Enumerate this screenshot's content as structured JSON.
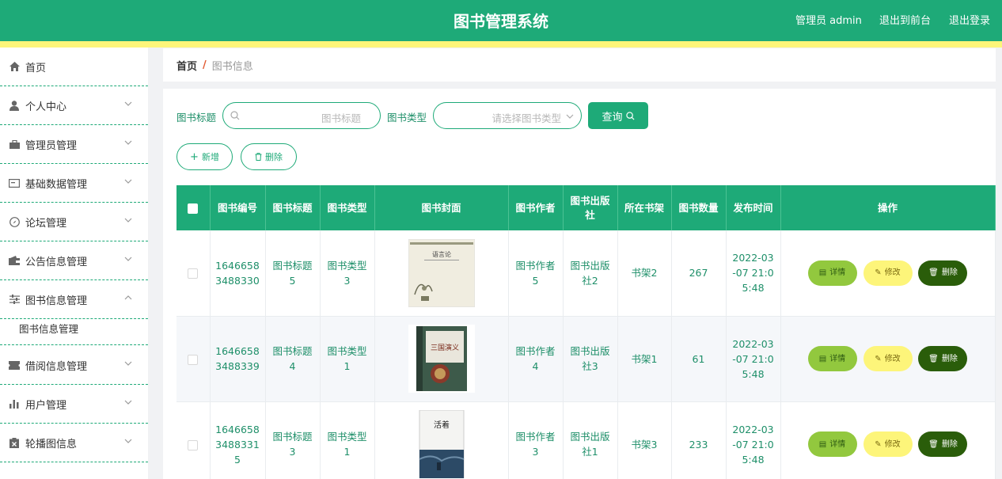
{
  "header": {
    "title": "图书管理系统",
    "admin_label": "管理员 admin",
    "front_label": "退出到前台",
    "logout_label": "退出登录"
  },
  "sidebar": {
    "items": [
      {
        "label": "首页",
        "icon": "home-icon"
      },
      {
        "label": "个人中心",
        "icon": "user-icon"
      },
      {
        "label": "管理员管理",
        "icon": "briefcase-icon"
      },
      {
        "label": "基础数据管理",
        "icon": "card-icon"
      },
      {
        "label": "论坛管理",
        "icon": "compass-icon"
      },
      {
        "label": "公告信息管理",
        "icon": "wallet-icon"
      },
      {
        "label": "图书信息管理",
        "icon": "sliders-icon"
      },
      {
        "label": "借阅信息管理",
        "icon": "ticket-icon"
      },
      {
        "label": "用户管理",
        "icon": "bar-chart-icon"
      },
      {
        "label": "轮播图信息",
        "icon": "clipboard-icon"
      }
    ],
    "sub_item": "图书信息管理"
  },
  "breadcrumb": {
    "home": "首页",
    "separator": "/",
    "current": "图书信息"
  },
  "search": {
    "title_label": "图书标题",
    "title_placeholder": "图书标题",
    "type_label": "图书类型",
    "type_placeholder": "请选择图书类型",
    "query_label": "查询"
  },
  "actions": {
    "add_label": "新增",
    "delete_label": "删除"
  },
  "table": {
    "headers": [
      "图书编号",
      "图书标题",
      "图书类型",
      "图书封面",
      "图书作者",
      "图书出版社",
      "所在书架",
      "图书数量",
      "发布时间",
      "操作"
    ],
    "rows": [
      {
        "id": "1646658\n3488330",
        "title": "图书标题\n5",
        "type": "图书类型\n3",
        "author": "图书作者\n5",
        "publisher": "图书出版\n社2",
        "shelf": "书架2",
        "qty": "267",
        "time": "2022-03\n-07 21:0\n5:48"
      },
      {
        "id": "1646658\n3488339",
        "title": "图书标题\n4",
        "type": "图书类型\n1",
        "author": "图书作者\n4",
        "publisher": "图书出版\n社3",
        "shelf": "书架1",
        "qty": "61",
        "time": "2022-03\n-07 21:0\n5:48"
      },
      {
        "id": "1646658\n3488331\n5",
        "title": "图书标题\n3",
        "type": "图书类型\n1",
        "author": "图书作者\n3",
        "publisher": "图书出版\n社1",
        "shelf": "书架3",
        "qty": "233",
        "time": "2022-03\n-07 21:0\n5:48"
      }
    ],
    "row_actions": {
      "detail": "详情",
      "edit": "修改",
      "delete": "删除"
    },
    "cover_texts": [
      "语言论",
      "三国演义",
      "活着"
    ]
  },
  "colors": {
    "primary": "#1eaa78",
    "accent_yellow": "#fdf57a",
    "detail_green": "#92c83e",
    "delete_dark": "#2a5d0a"
  }
}
